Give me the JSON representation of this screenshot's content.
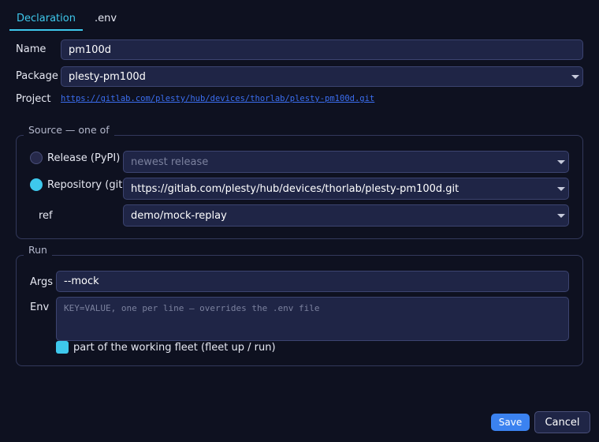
{
  "tabs": [
    {
      "label": "Declaration",
      "active": true
    },
    {
      "label": ".env",
      "active": false
    }
  ],
  "form": {
    "name_label": "Name",
    "name_value": "pm100d",
    "package_label": "Package",
    "package_value": "plesty-pm100d",
    "project_label": "Project",
    "project_link": "https://gitlab.com/plesty/hub/devices/thorlab/plesty-pm100d.git"
  },
  "source": {
    "legend": "Source — one of",
    "release_label": "Release (PyPI)",
    "release_selected": false,
    "release_placeholder": "newest release",
    "repository_label": "Repository (git)",
    "repository_selected": true,
    "repository_value": "https://gitlab.com/plesty/hub/devices/thorlab/plesty-pm100d.git",
    "ref_label": "ref",
    "ref_value": "demo/mock-replay"
  },
  "run": {
    "legend": "Run",
    "args_label": "Args",
    "args_value": "--mock",
    "env_label": "Env",
    "env_placeholder": "KEY=VALUE, one per line — overrides the .env file",
    "fleet_label": "part of the working fleet (fleet up / run)",
    "fleet_checked": true
  },
  "footer": {
    "save_label": "Save",
    "cancel_label": "Cancel"
  },
  "colors": {
    "background": "#0e1120",
    "accent": "#3ec8ec",
    "primary_button": "#3b82f0",
    "field_bg": "#1f2546",
    "link": "#3b6ef0"
  }
}
